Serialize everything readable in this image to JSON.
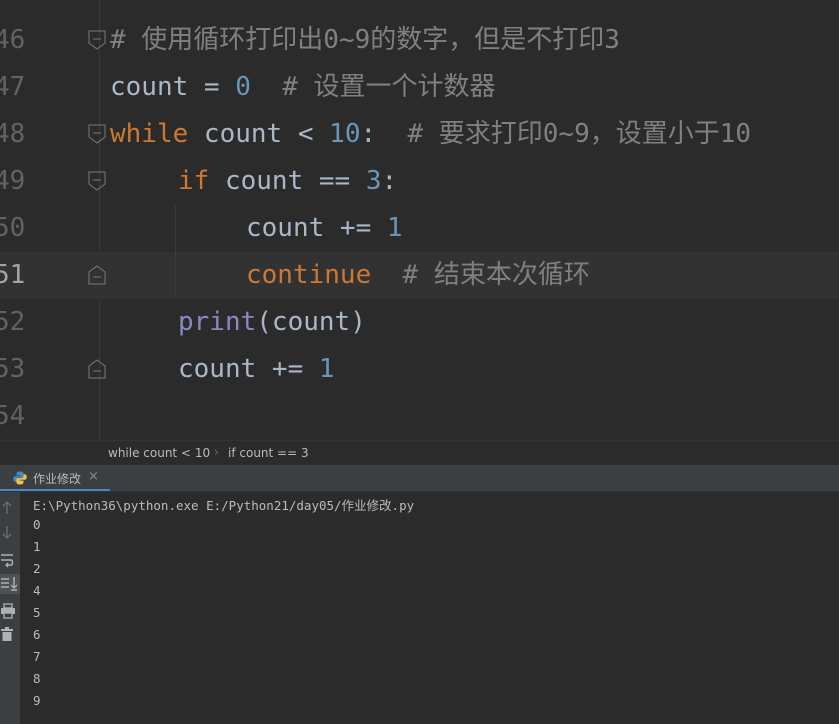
{
  "editor": {
    "lines": [
      {
        "num": "46",
        "comment": "# 使用循环打印出0~9的数字，但是不打印3"
      },
      {
        "num": "47",
        "code_a": "count = ",
        "code_b": "0",
        "comment": "# 设置一个计数器"
      },
      {
        "num": "48",
        "kw": "while",
        "code_a": " count < ",
        "code_b": "10",
        "code_c": ":",
        "comment": "# 要求打印0~9，设置小于10"
      },
      {
        "num": "49",
        "kw": "if",
        "code_a": " count == ",
        "code_b": "3",
        "code_c": ":"
      },
      {
        "num": "50",
        "code_a": "count += ",
        "code_b": "1"
      },
      {
        "num": "51",
        "kw": "continue",
        "comment": "# 结束本次循环"
      },
      {
        "num": "52",
        "builtin": "print",
        "code_a": "(count)"
      },
      {
        "num": "53",
        "code_a": "count += ",
        "code_b": "1"
      },
      {
        "num": "54"
      }
    ]
  },
  "breadcrumb": {
    "items": [
      "while count < 10",
      "if count == 3"
    ]
  },
  "run_panel": {
    "tab_label": "作业修改",
    "command": "E:\\Python36\\python.exe E:/Python21/day05/作业修改.py",
    "output": [
      "0",
      "1",
      "2",
      "4",
      "5",
      "6",
      "7",
      "8",
      "9"
    ]
  },
  "colors": {
    "background": "#2b2b2b",
    "keyword": "#cc7832",
    "number": "#6897bb",
    "comment": "#808080",
    "builtin": "#8888c6",
    "text": "#a9b7c6"
  },
  "icons": [
    "fold-icon",
    "python-file-icon",
    "close-icon",
    "arrow-up-icon",
    "arrow-down-icon",
    "soft-wrap-icon",
    "scroll-to-end-icon",
    "print-icon",
    "trash-icon"
  ]
}
